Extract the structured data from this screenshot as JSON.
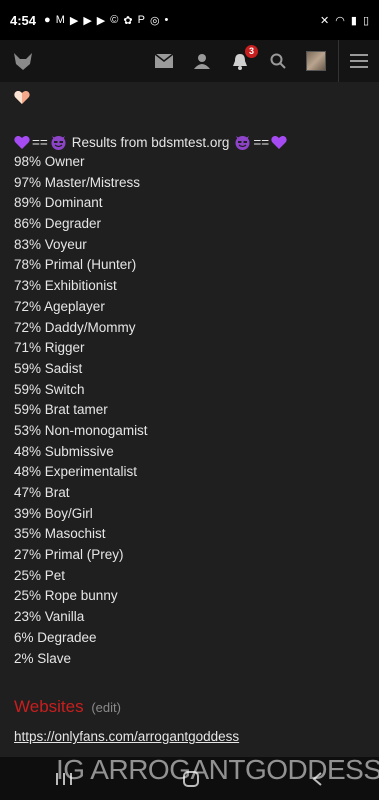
{
  "status": {
    "time": "4:54"
  },
  "results": {
    "title_text": "Results from bdsmtest.org",
    "title_separator": "==",
    "items": [
      "98% Owner",
      "97% Master/Mistress",
      "89% Dominant",
      "86% Degrader",
      "83% Voyeur",
      "78% Primal (Hunter)",
      "73% Exhibitionist",
      "72% Ageplayer",
      "72% Daddy/Mommy",
      "71% Rigger",
      "59% Sadist",
      "59% Switch",
      "59% Brat tamer",
      "53% Non-monogamist",
      "48% Submissive",
      "48% Experimentalist",
      "47% Brat",
      "39% Boy/Girl",
      "35% Masochist",
      "27% Primal (Prey)",
      "25% Pet",
      "25% Rope bunny",
      "23% Vanilla",
      "6% Degradee",
      "2% Slave"
    ]
  },
  "nav": {
    "notification_count": "3"
  },
  "websites": {
    "title": "Websites",
    "edit": "(edit)",
    "link": "https://onlyfans.com/arrogantgoddess"
  },
  "watermark": "IG ARROGANTGODDESS",
  "colors": {
    "accent_red": "#c81e1e",
    "heart_purple": "#a64bf4"
  }
}
